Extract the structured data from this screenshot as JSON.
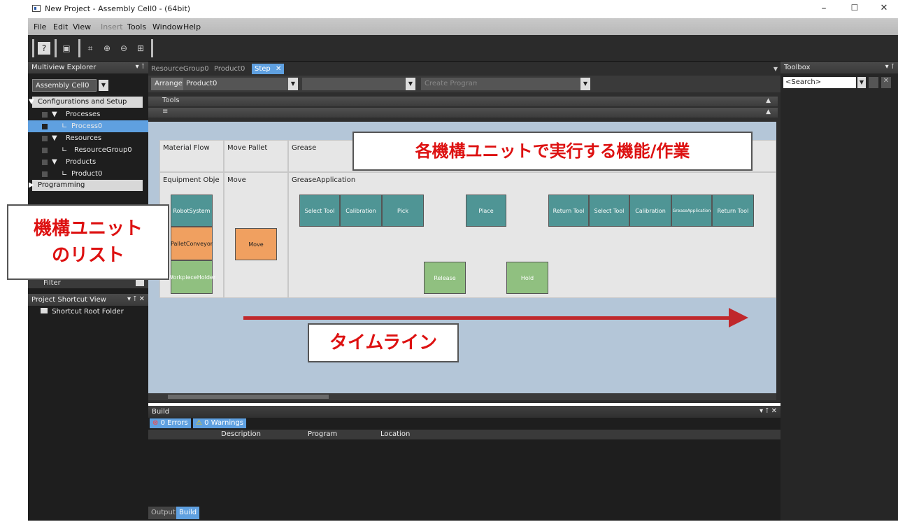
{
  "window": {
    "title": "New Project - Assembly Cell0 - (64bit)",
    "min": "–",
    "max": "☐",
    "close": "✕"
  },
  "menu": [
    "File",
    "Edit",
    "View",
    "Insert",
    "Tools",
    "Window",
    "Help"
  ],
  "left_panel": {
    "title": "Multiview Explorer",
    "device_select": "Assembly Cell0",
    "tree": [
      {
        "label": "Configurations and Setup",
        "type": "group"
      },
      {
        "label": "Processes",
        "type": "folder"
      },
      {
        "label": "Process0",
        "type": "leaf",
        "selected": true
      },
      {
        "label": "Resources",
        "type": "folder"
      },
      {
        "label": "ResourceGroup0",
        "type": "leaf"
      },
      {
        "label": "Products",
        "type": "folder"
      },
      {
        "label": "Product0",
        "type": "leaf"
      },
      {
        "label": "Programming",
        "type": "group"
      }
    ],
    "filter_label": "Filter",
    "shortcut_title": "Project Shortcut View",
    "shortcut_root": "Shortcut Root Folder"
  },
  "tabs": [
    {
      "label": "ResourceGroup0"
    },
    {
      "label": "Product0"
    },
    {
      "label": "Step",
      "active": true
    }
  ],
  "controls": {
    "arrange": "Arrange",
    "product": "Product0",
    "create_program": "Create Program"
  },
  "section_bars": {
    "tools": "Tools",
    "menu": "≡"
  },
  "lanes": {
    "row1": [
      "Material Flow",
      "Move Pallet",
      "Grease"
    ],
    "row2": [
      "Equipment Obje",
      "Move",
      "GreaseApplication"
    ]
  },
  "units": [
    "RobotSystem",
    "PalletConveyor",
    "WorkpieceHolder"
  ],
  "move_box": "Move",
  "steps_top": [
    "Select Tool",
    "Calibration",
    "Pick",
    "Place",
    "Return Tool",
    "Select Tool",
    "Calibration",
    "GreaseApplication",
    "Return Tool"
  ],
  "steps_bottom": [
    "Release",
    "Hold"
  ],
  "callouts": {
    "top": "各機構ユニットで実行する機能/作業",
    "left_line1": "機構ユニット",
    "left_line2": "のリスト",
    "bottom": "タイムライン"
  },
  "toolbox": {
    "title": "Toolbox",
    "search_placeholder": "<Search>"
  },
  "build": {
    "title": "Build",
    "errors": "0 Errors",
    "warnings": "0 Warnings",
    "columns": [
      "Description",
      "Program",
      "Location"
    ],
    "tabs": [
      "Output",
      "Build"
    ]
  },
  "colors": {
    "teal": "#4f9595",
    "green": "#90c080",
    "orange": "#f0a060",
    "arrow": "#c0282c",
    "callout_text": "#dd1111"
  }
}
